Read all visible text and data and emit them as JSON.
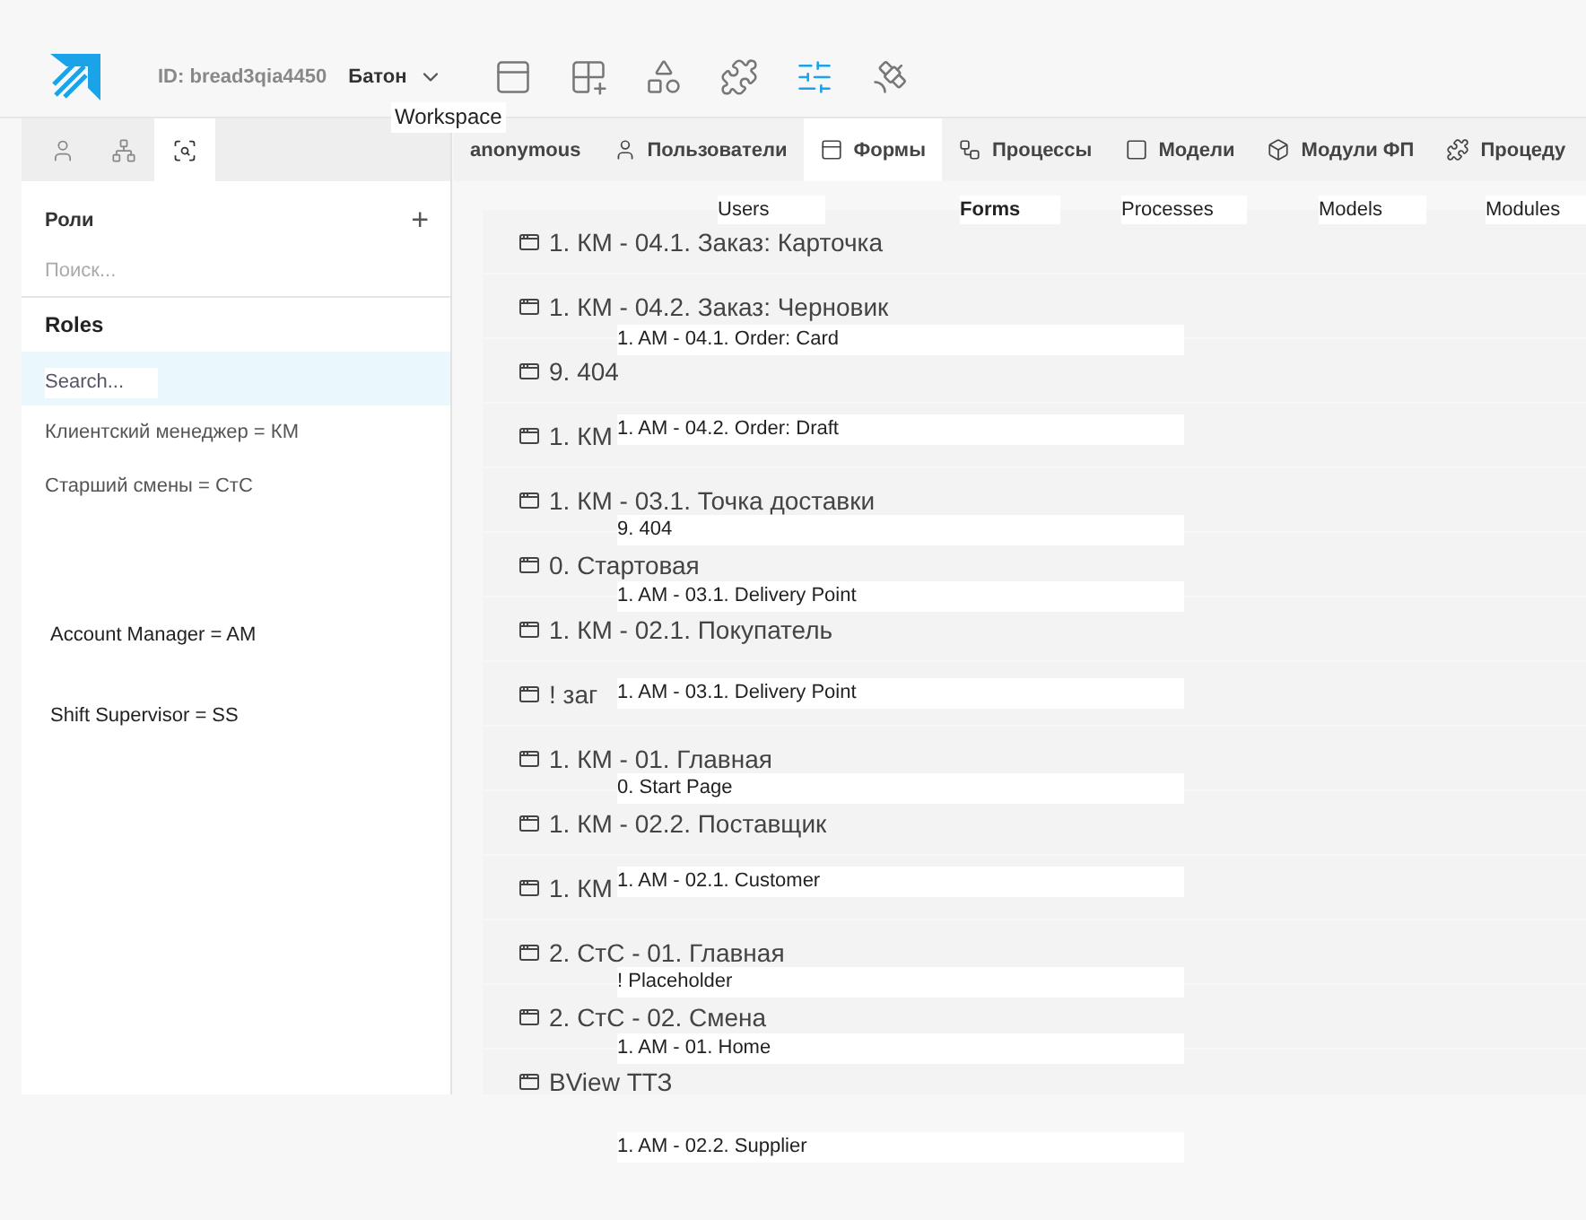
{
  "header": {
    "id_label": "ID: bread3qia4450",
    "workspace": "Батон",
    "tools": [
      {
        "kind": "forms",
        "selected": false
      },
      {
        "kind": "tables",
        "selected": false
      },
      {
        "kind": "shapes",
        "selected": false
      },
      {
        "kind": "plugins",
        "selected": false
      },
      {
        "kind": "settings",
        "selected": true
      },
      {
        "kind": "integrations",
        "selected": false
      }
    ]
  },
  "sidebar": {
    "tabs": [
      {
        "kind": "user",
        "selected": false
      },
      {
        "kind": "tree",
        "selected": false
      },
      {
        "kind": "roles",
        "selected": true
      }
    ],
    "title": "Роли",
    "add": "+",
    "search": {
      "placeholder": "Поиск..."
    },
    "roles": [
      {
        "selected": true
      },
      {
        "label": "Клиентский менеджер = КМ",
        "selected": false
      },
      {
        "label": "Старший смены = СтС",
        "selected": false
      }
    ]
  },
  "tabs": [
    {
      "label": "anonymous",
      "kind": "plain",
      "selected": false
    },
    {
      "label": "Пользователи",
      "kind": "user",
      "selected": false
    },
    {
      "label": "Формы",
      "kind": "form",
      "selected": true
    },
    {
      "label": "Процессы",
      "kind": "process",
      "selected": false
    },
    {
      "label": "Модели",
      "kind": "model",
      "selected": false
    },
    {
      "label": "Модули ФП",
      "kind": "module",
      "selected": false
    },
    {
      "label": "Процеду",
      "kind": "procedure",
      "selected": false
    }
  ],
  "forms": [
    "1. КМ - 04.1. Заказ: Карточка",
    "1. КМ - 04.2. Заказ: Черновик",
    "9. 404",
    "1. КМ",
    "1. КМ - 03.1. Точка доставки",
    "0. Стартовая",
    "1. КМ - 02.1. Покупатель",
    "! заг",
    "1. КМ - 01. Главная",
    "1. КМ - 02.2. Поставщик",
    "1. КМ",
    "2. СтС - 01. Главная",
    "2. СтС - 02. Смена",
    "BView ТТЗ"
  ],
  "translation_overlay": {
    "workspace": "Workspace",
    "sidebar": [
      "Roles",
      "Search...",
      "Account Manager = AM",
      "Shift Supervisor = SS"
    ],
    "tabs": [
      {
        "label": "Users",
        "bold": false
      },
      {
        "label": "Forms",
        "bold": true
      },
      {
        "label": "Processes",
        "bold": false
      },
      {
        "label": "Models",
        "bold": false
      },
      {
        "label": "Modules",
        "bold": false
      }
    ],
    "forms": [
      "1. AM - 04.1. Order: Card",
      "1. AM - 04.2. Order: Draft",
      "9. 404",
      "1. AM - 03.1. Delivery Point",
      "1. AM - 03.1. Delivery Point",
      "0. Start Page",
      "1. AM - 02.1. Customer",
      "! Placeholder",
      "1. AM - 01. Home",
      "1. AM - 02.2. Supplier"
    ]
  }
}
